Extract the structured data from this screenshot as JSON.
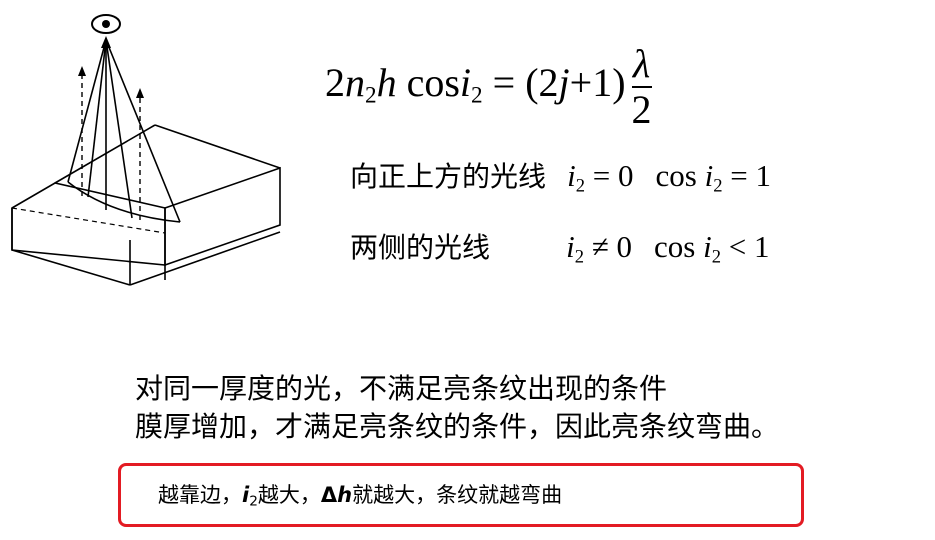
{
  "formula": {
    "lhs_coef": "2",
    "n": "n",
    "n_sub": "2",
    "h": "h",
    "cos": "cos",
    "i": "i",
    "i_sub": "2",
    "eq": "=",
    "rhs": "(2",
    "j": "j",
    "rhs2": "+1)",
    "lambda": "λ",
    "den": "2"
  },
  "rows": [
    {
      "label": "向正上方的光线",
      "i": "i",
      "i_sub": "2",
      "rel": "= 0",
      "cos": "cos",
      "cos_i": "i",
      "cos_i_sub": "2",
      "cos_rel": "= 1"
    },
    {
      "label": "两侧的光线",
      "i": "i",
      "i_sub": "2",
      "rel": "≠ 0",
      "cos": "cos",
      "cos_i": "i",
      "cos_i_sub": "2",
      "cos_rel": "< 1"
    }
  ],
  "paragraph": {
    "line1": "对同一厚度的光，不满足亮条纹出现的条件",
    "line2": "膜厚增加，才满足亮条纹的条件，因此亮条纹弯曲。"
  },
  "callout": {
    "part1": "越靠边，",
    "i": "i",
    "i_sub": "2",
    "part2": "越大，",
    "delta": "Δ",
    "h": "h",
    "part3": "就越大，条纹就越弯曲"
  },
  "colors": {
    "box_border": "#e31b23",
    "ink": "#000000"
  }
}
